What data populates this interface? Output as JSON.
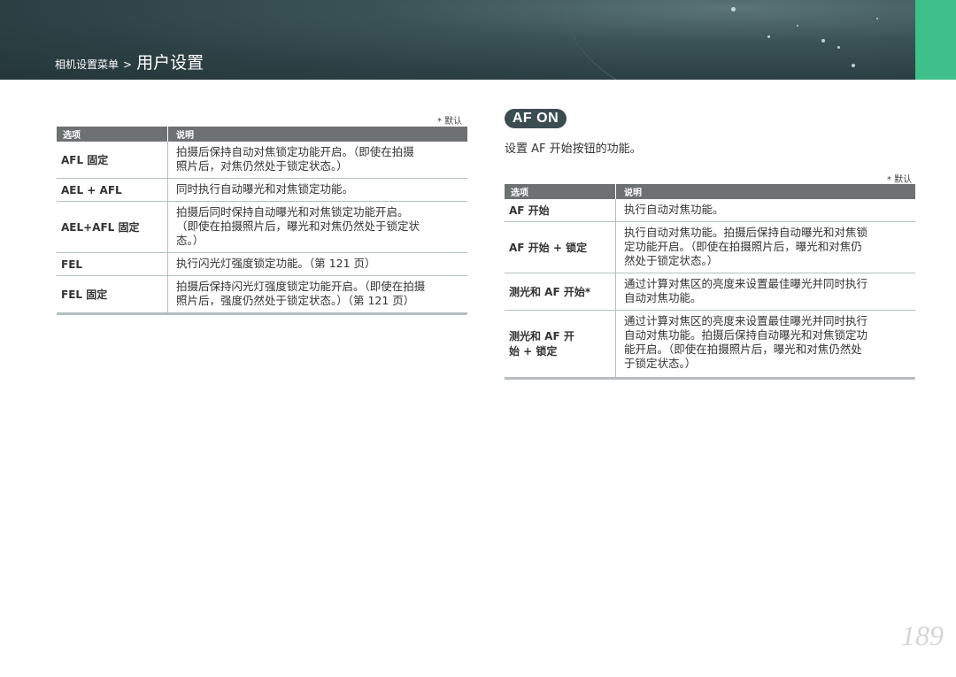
{
  "header": {
    "breadcrumb_parent": "相机设置菜单",
    "separator": ">",
    "title": "用户设置"
  },
  "left_table": {
    "default_note": "* 默认",
    "columns": [
      "选项",
      "说明"
    ],
    "rows": [
      {
        "option": "AFL 固定",
        "desc": [
          "拍摄后保持自动对焦锁定功能开启。（即使在拍摄",
          "照片后，对焦仍然处于锁定状态。）"
        ]
      },
      {
        "option": "AEL + AFL",
        "desc": [
          "同时执行自动曝光和对焦锁定功能。"
        ]
      },
      {
        "option": "AEL+AFL 固定",
        "desc": [
          "拍摄后同时保持自动曝光和对焦锁定功能开启。",
          "（即使在拍摄照片后，曝光和对焦仍然处于锁定状",
          "态。）"
        ]
      },
      {
        "option": "FEL",
        "desc": [
          "执行闪光灯强度锁定功能。（第 121 页）"
        ]
      },
      {
        "option": "FEL 固定",
        "desc": [
          "拍摄后保持闪光灯强度锁定功能开启。（即使在拍摄",
          "照片后，强度仍然处于锁定状态。）（第 121 页）"
        ]
      }
    ]
  },
  "af_on": {
    "badge": "AF ON",
    "description": "设置 AF 开始按钮的功能。",
    "default_note": "* 默认",
    "columns": [
      "选项",
      "说明"
    ],
    "rows": [
      {
        "option": "AF 开始",
        "desc": [
          "执行自动对焦功能。"
        ]
      },
      {
        "option": "AF 开始 + 锁定",
        "desc": [
          "执行自动对焦功能。拍摄后保持自动曝光和对焦锁",
          "定功能开启。（即使在拍摄照片后，曝光和对焦仍",
          "然处于锁定状态。）"
        ]
      },
      {
        "option": "测光和 AF 开始*",
        "desc": [
          "通过计算对焦区的亮度来设置最佳曝光并同时执行",
          "自动对焦功能。"
        ]
      },
      {
        "option": "测光和 AF 开始 + 锁定",
        "desc": [
          "通过计算对焦区的亮度来设置最佳曝光并同时执行",
          "自动对焦功能。拍摄后保持自动曝光和对焦锁定功",
          "能开启。（即使在拍摄照片后，曝光和对焦仍然处",
          "于锁定状态。）"
        ]
      }
    ]
  },
  "page_number": "189",
  "colors": {
    "header_bg": "#2c4044",
    "green_tab": "#3fc08a",
    "table_header": "#6e7172",
    "badge_bg": "#3c4d52"
  }
}
